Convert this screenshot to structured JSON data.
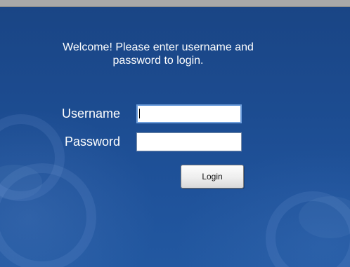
{
  "welcome": {
    "line1": "Welcome! Please enter username and",
    "line2": "password to login."
  },
  "form": {
    "username_label": "Username",
    "password_label": "Password",
    "username_value": "",
    "password_value": "",
    "login_label": "Login"
  },
  "colors": {
    "background": "#1d4c8e",
    "text": "#ffffff",
    "top_bar": "#a8a8a8",
    "focused_field_border": "#6f9fdc"
  }
}
